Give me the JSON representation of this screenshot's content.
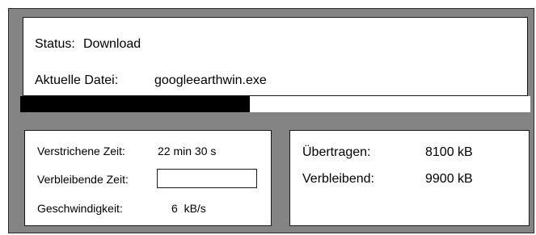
{
  "status": {
    "label": "Status:",
    "value": "Download"
  },
  "current_file": {
    "label": "Aktuelle Datei:",
    "value": "googleearthwin.exe"
  },
  "progress": {
    "fraction": 0.45
  },
  "time": {
    "elapsed_label": "Verstrichene Zeit:",
    "elapsed_value": "22 min 30 s",
    "remaining_label": "Verbleibende Zeit:",
    "remaining_value": "",
    "speed_label": "Geschwindigkeit:",
    "speed_value": "6  kB/s"
  },
  "transfer": {
    "transferred_label": "Übertragen:",
    "transferred_value": "8100 kB",
    "remaining_label": "Verbleibend:",
    "remaining_value": "9900 kB"
  },
  "colors": {
    "window_background": "#848484",
    "progress_fill": "#000000",
    "progress_track": "#ffffff"
  }
}
